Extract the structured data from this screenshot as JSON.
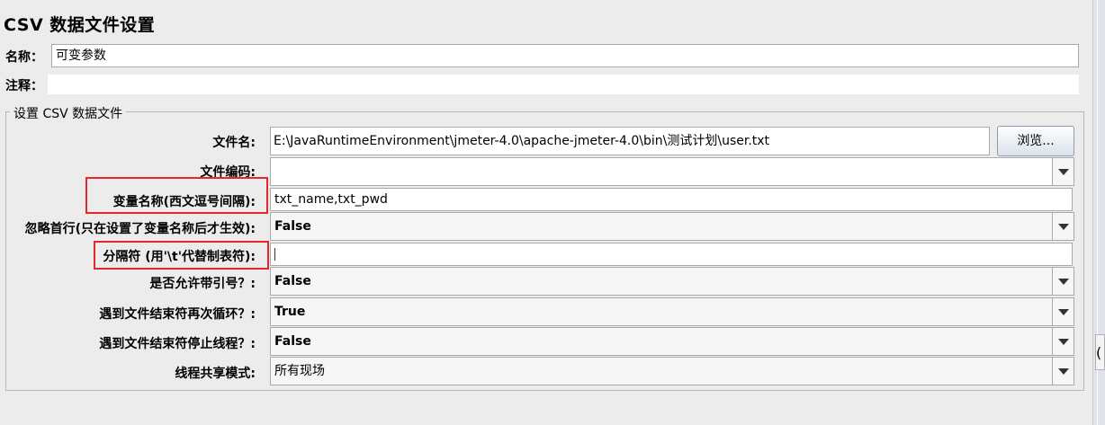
{
  "title": "CSV 数据文件设置",
  "name_label": "名称：",
  "name_value": "可变参数",
  "comment_label": "注释：",
  "comment_value": "",
  "group_title": "设置 CSV 数据文件",
  "filename": {
    "label": "文件名:",
    "value": "E:\\JavaRuntimeEnvironment\\jmeter-4.0\\apache-jmeter-4.0\\bin\\测试计划\\user.txt",
    "browse_label": "浏览..."
  },
  "encoding": {
    "label": "文件编码:",
    "value": ""
  },
  "variable_names": {
    "label": "变量名称(西文逗号间隔):",
    "value": "txt_name,txt_pwd"
  },
  "ignore_first_line": {
    "label": "忽略首行(只在设置了变量名称后才生效):",
    "value": "False"
  },
  "delimiter": {
    "label": "分隔符 (用'\\t'代替制表符):",
    "value": ""
  },
  "allow_quoted": {
    "label": "是否允许带引号？:",
    "value": "False"
  },
  "recycle_eof": {
    "label": "遇到文件结束符再次循环？:",
    "value": "True"
  },
  "stop_thread_eof": {
    "label": "遇到文件结束符停止线程？:",
    "value": "False"
  },
  "sharing_mode": {
    "label": "线程共享模式:",
    "value": "所有现场"
  },
  "right_tab_fragment": "(",
  "colors": {
    "highlight_box": "#e3272b",
    "panel_bg": "#ececec"
  }
}
